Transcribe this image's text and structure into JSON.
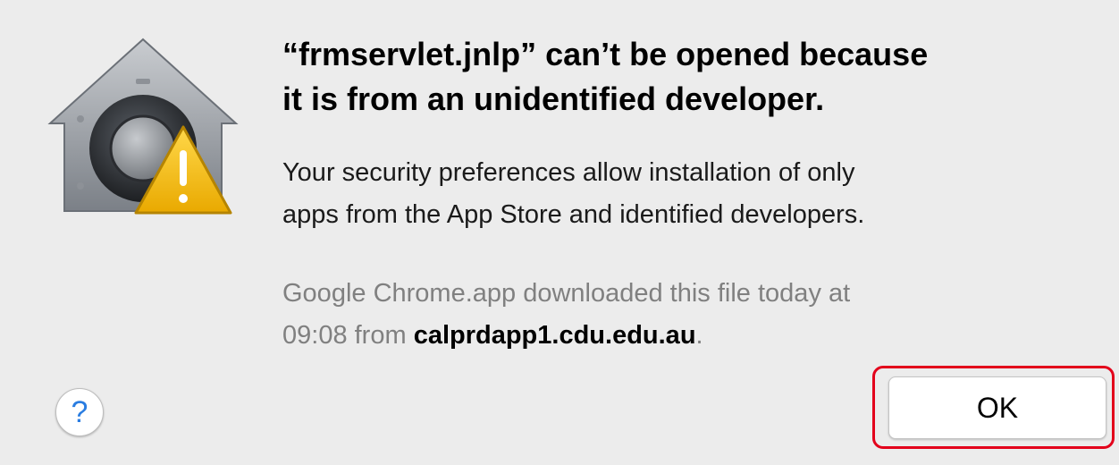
{
  "dialog": {
    "title_lines": [
      "“frmservlet.jnlp” can’t be opened because",
      "it is from an unidentified developer."
    ],
    "message_lines": [
      "Your security preferences allow installation of only",
      "apps from the App Store and identified developers."
    ],
    "source": {
      "line1": "Google Chrome.app downloaded this file today at",
      "line2_prefix": "09:08 from ",
      "host": "calprdapp1.cdu.edu.au",
      "line2_suffix": "."
    },
    "help_button_label": "?",
    "ok_button_label": "OK"
  },
  "icons": {
    "main": "security-gatekeeper-house-icon",
    "warning": "warning-triangle-icon"
  },
  "colors": {
    "dialog_background": "#ececec",
    "highlight_border": "#e3001b",
    "help_glyph": "#2a7de1",
    "warning_fill": "#f4c400"
  }
}
